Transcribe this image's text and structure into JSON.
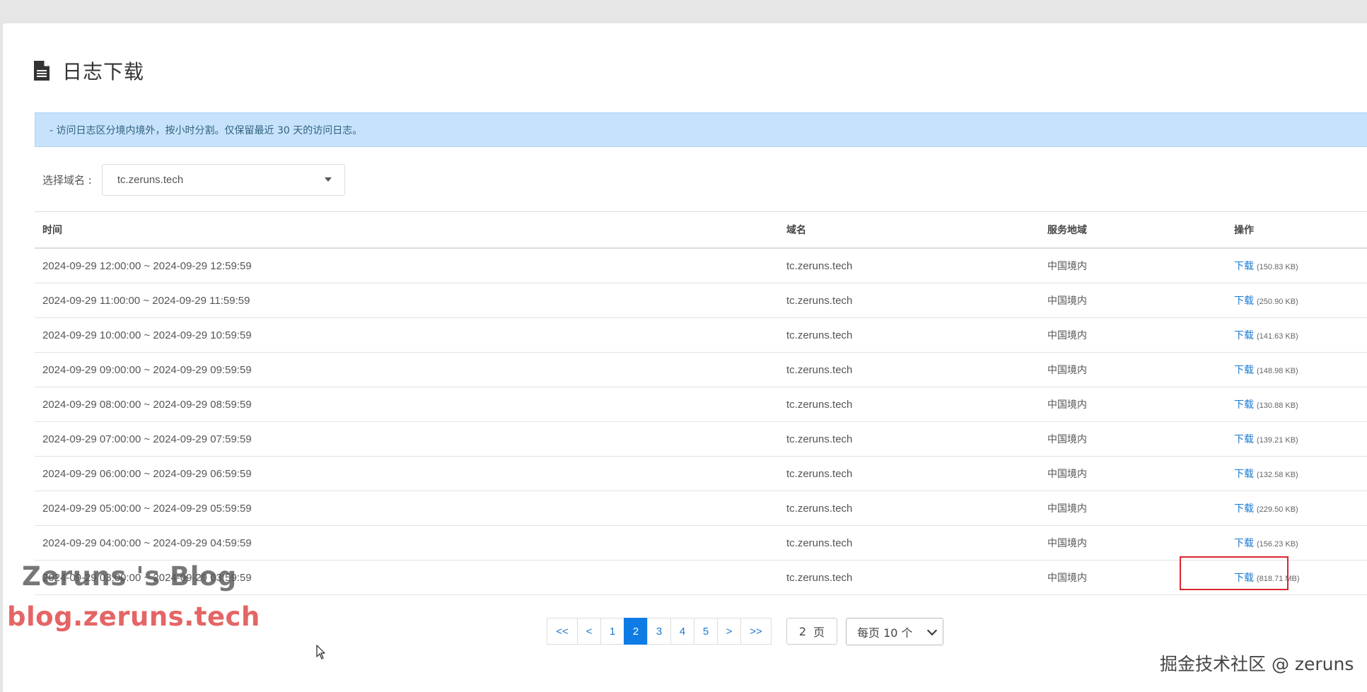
{
  "page": {
    "title": "日志下载",
    "title_icon": "document-icon",
    "notice": "- 访问日志区分境内境外，按小时分割。仅保留最近 30 天的访问日志。"
  },
  "domain_select": {
    "label": "选择域名 :",
    "value": "tc.zeruns.tech"
  },
  "table": {
    "headers": [
      "时间",
      "域名",
      "服务地域",
      "操作"
    ],
    "download_label": "下载",
    "rows": [
      {
        "time": "2024-09-29 12:00:00 ~ 2024-09-29 12:59:59",
        "domain": "tc.zeruns.tech",
        "region": "中国境内",
        "size": "(150.83 KB)"
      },
      {
        "time": "2024-09-29 11:00:00 ~ 2024-09-29 11:59:59",
        "domain": "tc.zeruns.tech",
        "region": "中国境内",
        "size": "(250.90 KB)"
      },
      {
        "time": "2024-09-29 10:00:00 ~ 2024-09-29 10:59:59",
        "domain": "tc.zeruns.tech",
        "region": "中国境内",
        "size": "(141.63 KB)"
      },
      {
        "time": "2024-09-29 09:00:00 ~ 2024-09-29 09:59:59",
        "domain": "tc.zeruns.tech",
        "region": "中国境内",
        "size": "(148.98 KB)"
      },
      {
        "time": "2024-09-29 08:00:00 ~ 2024-09-29 08:59:59",
        "domain": "tc.zeruns.tech",
        "region": "中国境内",
        "size": "(130.88 KB)"
      },
      {
        "time": "2024-09-29 07:00:00 ~ 2024-09-29 07:59:59",
        "domain": "tc.zeruns.tech",
        "region": "中国境内",
        "size": "(139.21 KB)"
      },
      {
        "time": "2024-09-29 06:00:00 ~ 2024-09-29 06:59:59",
        "domain": "tc.zeruns.tech",
        "region": "中国境内",
        "size": "(132.58 KB)"
      },
      {
        "time": "2024-09-29 05:00:00 ~ 2024-09-29 05:59:59",
        "domain": "tc.zeruns.tech",
        "region": "中国境内",
        "size": "(229.50 KB)"
      },
      {
        "time": "2024-09-29 04:00:00 ~ 2024-09-29 04:59:59",
        "domain": "tc.zeruns.tech",
        "region": "中国境内",
        "size": "(156.23 KB)"
      },
      {
        "time": "2024-09-29 03:00:00 ~ 2024-09-29 03:59:59",
        "domain": "tc.zeruns.tech",
        "region": "中国境内",
        "size": "(818.71 MB)"
      }
    ]
  },
  "pagination": {
    "first": "<<",
    "prev": "<",
    "pages": [
      "1",
      "2",
      "3",
      "4",
      "5"
    ],
    "current": "2",
    "next": ">",
    "last": ">>",
    "goto_value": "2",
    "goto_unit": "页",
    "per_page": "每页 10 个"
  },
  "watermarks": {
    "blog_name": "Zeruns 's Blog",
    "blog_url": "blog.zeruns.tech",
    "juejin": "掘金技术社区 @ zeruns"
  },
  "colors": {
    "accent": "#0f7be5",
    "link": "#1a7ad1",
    "notice_bg": "#c7e3fb",
    "highlight": "#d9252f"
  }
}
